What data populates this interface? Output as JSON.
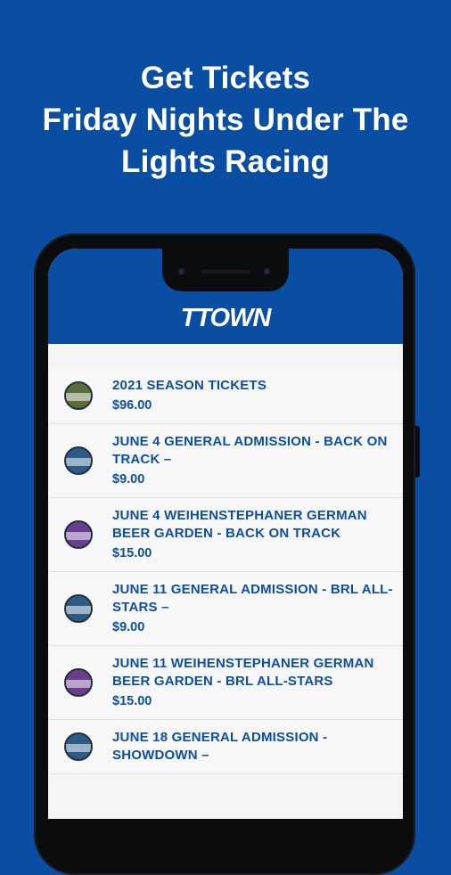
{
  "headline": {
    "line1": "Get Tickets",
    "line2": "Friday Nights Under The",
    "line3": "Lights Racing"
  },
  "app": {
    "logo": "TTOWN",
    "brand_color": "#0a4ea3"
  },
  "tickets": [
    {
      "title": "2021 SEASON TICKETS",
      "price": "$96.00",
      "icon": "season-ticket-icon",
      "icon_color": "#5b6d3a"
    },
    {
      "title": "JUNE 4 GENERAL ADMISSION - BACK ON TRACK –",
      "price": "$9.00",
      "icon": "general-admission-ticket-icon",
      "icon_color": "#2d5a86"
    },
    {
      "title": "JUNE 4 WEIHENSTEPHANER GERMAN BEER GARDEN - BACK ON TRACK",
      "price": "$15.00",
      "icon": "beer-garden-ticket-icon",
      "icon_color": "#6a3d8f"
    },
    {
      "title": "JUNE 11 GENERAL ADMISSION - BRL ALL-STARS –",
      "price": "$9.00",
      "icon": "general-admission-ticket-icon",
      "icon_color": "#2d5a86"
    },
    {
      "title": "JUNE 11 WEIHENSTEPHANER GERMAN BEER GARDEN - BRL ALL-STARS",
      "price": "$15.00",
      "icon": "beer-garden-ticket-icon",
      "icon_color": "#6a3d8f"
    },
    {
      "title": "JUNE 18 GENERAL ADMISSION - SHOWDOWN –",
      "price": "",
      "icon": "general-admission-ticket-icon",
      "icon_color": "#2d5a86"
    }
  ]
}
